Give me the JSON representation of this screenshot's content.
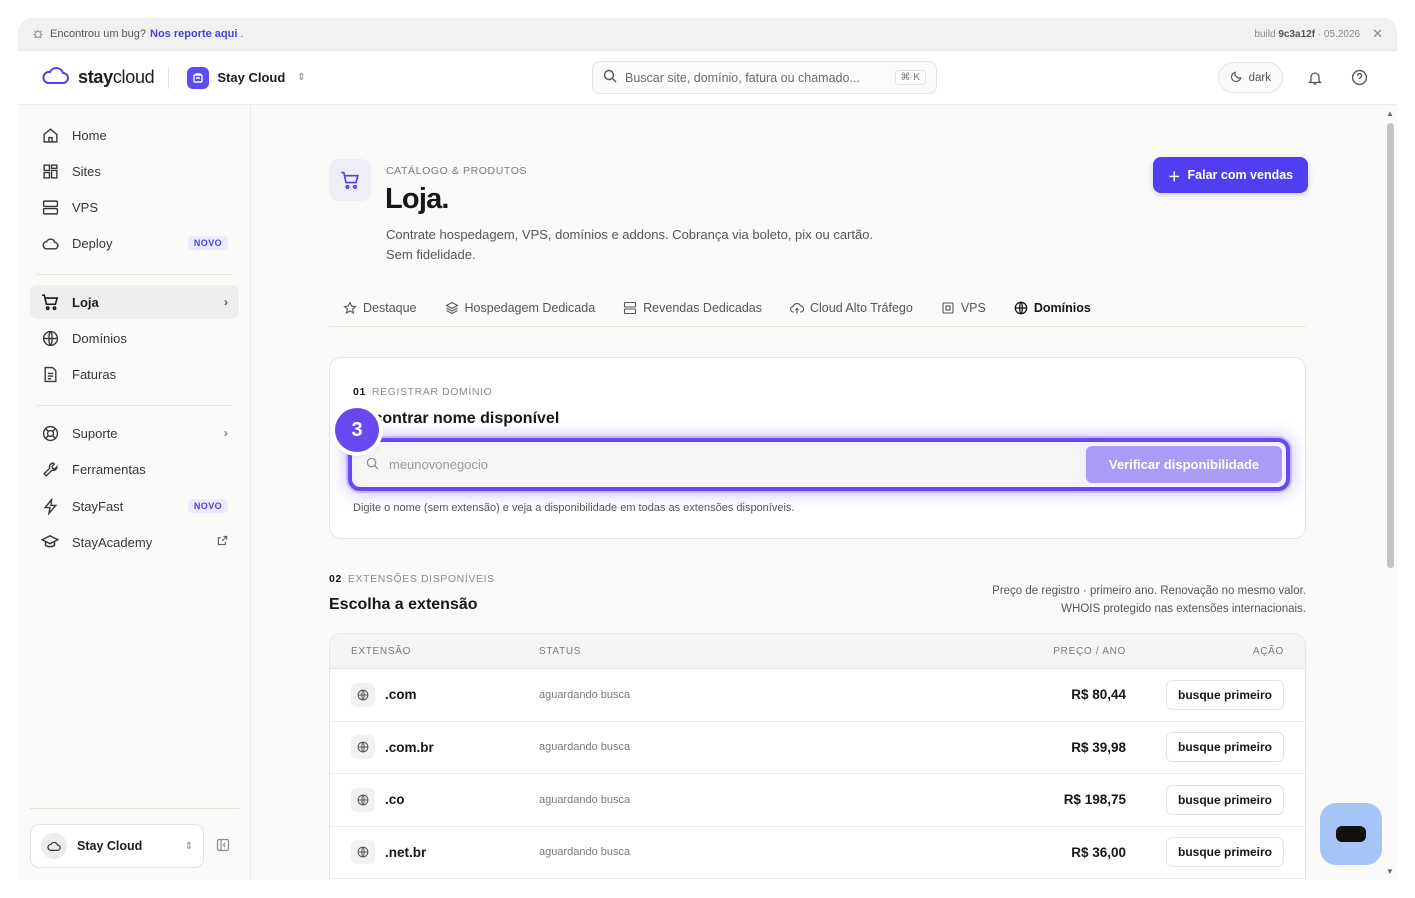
{
  "banner": {
    "text": "Encontrou um bug?",
    "link": "Nos reporte aqui",
    "link_suffix": ".",
    "build_label": "build",
    "build_hash": "9c3a12f",
    "build_date": "· 05.2026"
  },
  "topbar": {
    "logo_bold": "stay",
    "logo_light": "cloud",
    "org_name": "Stay Cloud",
    "search_placeholder": "Buscar site, domínio, fatura ou chamado...",
    "shortcut": "⌘ K",
    "theme_label": "dark"
  },
  "sidebar": {
    "items": [
      {
        "label": "Home",
        "icon": "home-icon"
      },
      {
        "label": "Sites",
        "icon": "grid-icon"
      },
      {
        "label": "VPS",
        "icon": "server-icon"
      },
      {
        "label": "Deploy",
        "icon": "cloud-icon",
        "badge": "NOVO"
      },
      {
        "label": "Loja",
        "icon": "cart-icon",
        "active": true
      },
      {
        "label": "Domínios",
        "icon": "globe-icon"
      },
      {
        "label": "Faturas",
        "icon": "document-icon"
      },
      {
        "label": "Suporte",
        "icon": "lifebuoy-icon"
      },
      {
        "label": "Ferramentas",
        "icon": "wrench-icon"
      },
      {
        "label": "StayFast",
        "icon": "bolt-icon",
        "badge": "NOVO"
      },
      {
        "label": "StayAcademy",
        "icon": "graduation-cap-icon"
      }
    ],
    "workspace": "Stay Cloud"
  },
  "header": {
    "eyebrow": "CATÁLOGO & PRODUTOS",
    "title": "Loja.",
    "description_line1": "Contrate hospedagem, VPS, domínios e addons. Cobrança via boleto, pix ou cartão.",
    "description_line2": "Sem fidelidade.",
    "cta_label": "Falar com vendas"
  },
  "tabs": [
    {
      "label": "Destaque",
      "icon": "star-icon"
    },
    {
      "label": "Hospedagem Dedicada",
      "icon": "layers-icon"
    },
    {
      "label": "Revendas Dedicadas",
      "icon": "server-icon"
    },
    {
      "label": "Cloud Alto Tráfego",
      "icon": "cloud-upload-icon"
    },
    {
      "label": "VPS",
      "icon": "chip-icon"
    },
    {
      "label": "Domínios",
      "icon": "globe-icon",
      "active": true
    }
  ],
  "register": {
    "step_number": "01",
    "step_label": "REGISTRAR DOMÍNIO",
    "title": "Encontrar nome disponível",
    "input_placeholder": "meunovonegocio",
    "button_label": "Verificar disponibilidade",
    "hint": "Digite o nome (sem extensão) e veja a disponibilidade em todas as extensões disponíveis.",
    "tour_step": "3"
  },
  "extensions": {
    "step_number": "02",
    "step_label": "EXTENSÕES DISPONÍVEIS",
    "title": "Escolha a extensão",
    "note_line1": "Preço de registro · primeiro ano. Renovação no mesmo valor.",
    "note_line2": "WHOIS protegido nas extensões internacionais.",
    "columns": [
      "EXTENSÃO",
      "STATUS",
      "PREÇO / ANO",
      "AÇÃO"
    ],
    "rows": [
      {
        "ext": ".com",
        "status": "aguardando busca",
        "price": "R$ 80,44",
        "action": "busque primeiro"
      },
      {
        "ext": ".com.br",
        "status": "aguardando busca",
        "price": "R$ 39,98",
        "action": "busque primeiro"
      },
      {
        "ext": ".co",
        "status": "aguardando busca",
        "price": "R$ 198,75",
        "action": "busque primeiro"
      },
      {
        "ext": ".net.br",
        "status": "aguardando busca",
        "price": "R$ 36,00",
        "action": "busque primeiro"
      }
    ]
  },
  "colors": {
    "accent": "#4f3ff0",
    "highlight": "#6a48f0",
    "chat_fab": "#a7c4f7"
  }
}
